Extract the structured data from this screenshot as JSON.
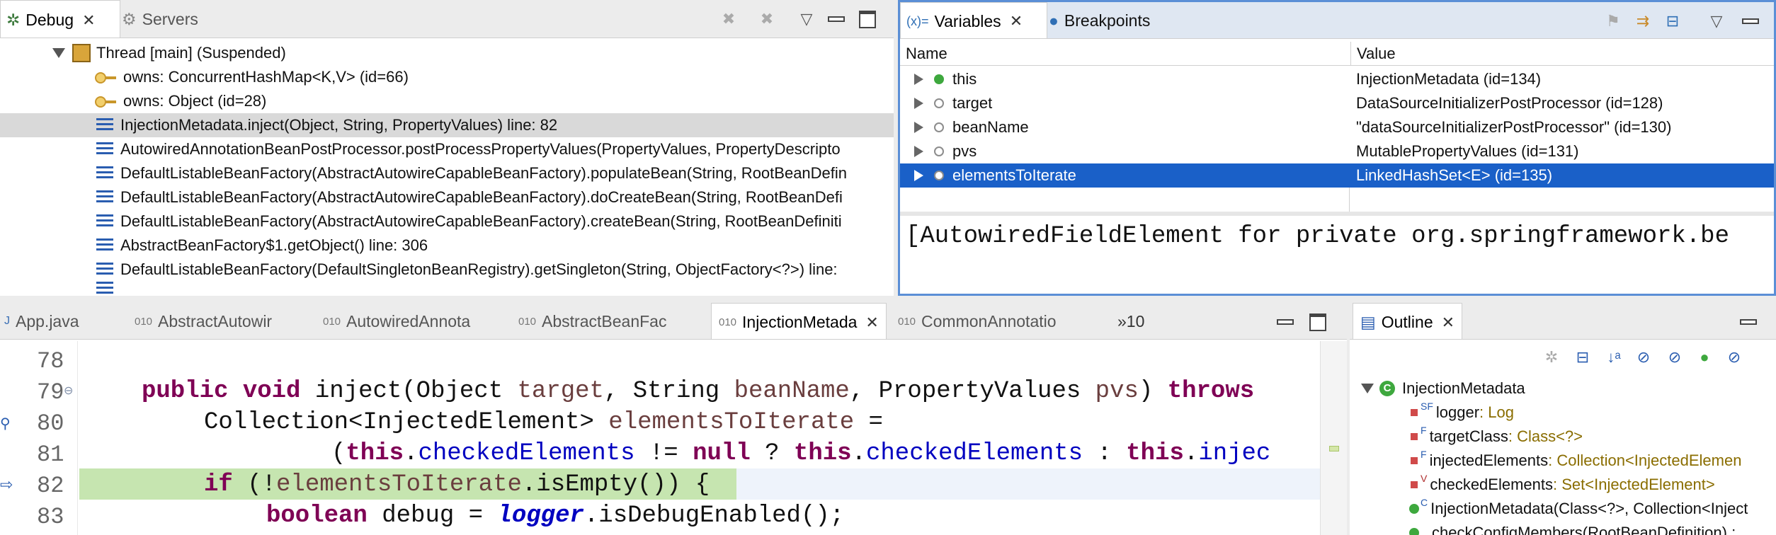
{
  "debug_view": {
    "tabs": [
      {
        "label": "Debug",
        "icon": "bug-icon"
      },
      {
        "label": "Servers",
        "icon": "servers-icon"
      }
    ],
    "thread": "Thread [main] (Suspended)",
    "rows": [
      {
        "text": "owns: ConcurrentHashMap<K,V>  (id=66)",
        "icon": "key-icon"
      },
      {
        "text": "owns: Object  (id=28)",
        "icon": "key-icon"
      },
      {
        "text": "InjectionMetadata.inject(Object, String, PropertyValues) line: 82",
        "icon": "stack-frame-icon",
        "selected": true
      },
      {
        "text": "AutowiredAnnotationBeanPostProcessor.postProcessPropertyValues(PropertyValues, PropertyDescripto",
        "icon": "stack-frame-icon"
      },
      {
        "text": "DefaultListableBeanFactory(AbstractAutowireCapableBeanFactory).populateBean(String, RootBeanDefin",
        "icon": "stack-frame-icon"
      },
      {
        "text": "DefaultListableBeanFactory(AbstractAutowireCapableBeanFactory).doCreateBean(String, RootBeanDefi",
        "icon": "stack-frame-icon"
      },
      {
        "text": "DefaultListableBeanFactory(AbstractAutowireCapableBeanFactory).createBean(String, RootBeanDefiniti",
        "icon": "stack-frame-icon"
      },
      {
        "text": "AbstractBeanFactory$1.getObject() line: 306",
        "icon": "stack-frame-icon"
      },
      {
        "text": "DefaultListableBeanFactory(DefaultSingletonBeanRegistry).getSingleton(String, ObjectFactory<?>) line:",
        "icon": "stack-frame-icon"
      }
    ]
  },
  "variables_view": {
    "tabs": [
      {
        "label": "Variables",
        "icon": "variables-icon",
        "prefix": "(x)="
      },
      {
        "label": "Breakpoints",
        "icon": "breakpoints-icon"
      }
    ],
    "columns": [
      "Name",
      "Value"
    ],
    "rows": [
      {
        "name": "this",
        "value": "InjectionMetadata  (id=134)",
        "dot_color": "#3ea83e"
      },
      {
        "name": "target",
        "value": "DataSourceInitializerPostProcessor  (id=128)",
        "dot_color": "#8c8c8c"
      },
      {
        "name": "beanName",
        "value": "\"dataSourceInitializerPostProcessor\" (id=130)",
        "dot_color": "#8c8c8c"
      },
      {
        "name": "pvs",
        "value": "MutablePropertyValues  (id=131)",
        "dot_color": "#8c8c8c"
      },
      {
        "name": "elementsToIterate",
        "value": "LinkedHashSet<E>  (id=135)",
        "dot_color": "#8c8c8c",
        "selected": true
      }
    ],
    "detail": "[AutowiredFieldElement for private org.springframework.be",
    "selection_color": "#1a60c8"
  },
  "editor": {
    "tabs": [
      {
        "label": "App.java"
      },
      {
        "label": "AbstractAutowir"
      },
      {
        "label": "AutowiredAnnota"
      },
      {
        "label": "AbstractBeanFac"
      },
      {
        "label": "InjectionMetada",
        "active": true
      },
      {
        "label": "CommonAnnotatio"
      }
    ],
    "overflow_label": "»10",
    "line_numbers": [
      "78",
      "79",
      "80",
      "81",
      "82",
      "83"
    ],
    "current_line_color": "#c6e5b0"
  },
  "outline_view": {
    "tab": "Outline",
    "root": "InjectionMetadata",
    "items": [
      {
        "name": "logger",
        "type": " : Log",
        "marker": "SF"
      },
      {
        "name": "targetClass",
        "type": " : Class<?>",
        "marker": "F"
      },
      {
        "name": "injectedElements",
        "type": " : Collection<InjectedElemen",
        "marker": "F"
      },
      {
        "name": "checkedElements",
        "type": " : Set<InjectedElement>",
        "marker": "V"
      },
      {
        "name": "InjectionMetadata(Class<?>, Collection<Inject",
        "type": "",
        "marker": "C"
      },
      {
        "name": "checkConfigMembers(RootBeanDefinition) :",
        "type": "",
        "marker": ""
      }
    ]
  }
}
